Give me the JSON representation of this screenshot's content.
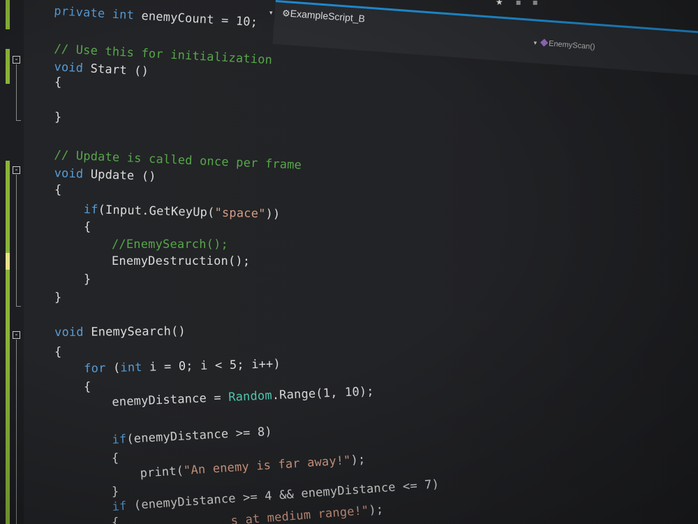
{
  "navigation": {
    "file_combo_arrow": "▾",
    "class_combo": "ExampleScript_B",
    "member_combo": "EnemyScan()",
    "member_combo_arrow": "▾"
  },
  "colors": {
    "keyword": "#569cd6",
    "comment": "#57a64a",
    "string": "#d69d85",
    "type": "#4ec9b0",
    "text": "#dcdcdc",
    "change_saved": "#8ab438",
    "change_unsaved": "#e9e08a",
    "accent": "#1f8fd6"
  },
  "code": {
    "l1": {
      "a": "private",
      "b": " ",
      "c": "int",
      "d": " enemyCount = 10;"
    },
    "l2": {
      "a": "// Use this for initialization"
    },
    "l3": {
      "a": "void",
      "b": " Start ()"
    },
    "l4": {
      "a": "{"
    },
    "l5": {
      "a": "}"
    },
    "l6": {
      "a": "// Update is called once per frame"
    },
    "l7": {
      "a": "void",
      "b": " Update ()"
    },
    "l8": {
      "a": "{"
    },
    "l9": {
      "a": "if",
      "b": "(Input.GetKeyUp(",
      "c": "\"space\"",
      "d": "))"
    },
    "l10": {
      "a": "{"
    },
    "l11": {
      "a": "//EnemySearch();"
    },
    "l12": {
      "a": "EnemyDestruction();"
    },
    "l13": {
      "a": "}"
    },
    "l14": {
      "a": "}"
    },
    "l15": {
      "a": "void",
      "b": " EnemySearch()"
    },
    "l16": {
      "a": "{"
    },
    "l17": {
      "a": "for",
      "b": " (",
      "c": "int",
      "d": " i = 0; i < 5; i++)"
    },
    "l18": {
      "a": "{"
    },
    "l19": {
      "a": "enemyDistance = ",
      "b": "Random",
      "c": ".Range(1, 10);"
    },
    "l20": {
      "a": "if",
      "b": "(enemyDistance >= 8)"
    },
    "l21": {
      "a": "{"
    },
    "l22": {
      "a": "print(",
      "b": "\"An enemy is far away!\"",
      "c": ");"
    },
    "l23": {
      "a": "}"
    },
    "l24": {
      "a": "if",
      "b": " (enemyDistance >= 4 && enemyDistance <= 7)"
    },
    "l25": {
      "a": "{"
    },
    "l26": {
      "a": "s at medium range!\"",
      "b": ");"
    }
  }
}
